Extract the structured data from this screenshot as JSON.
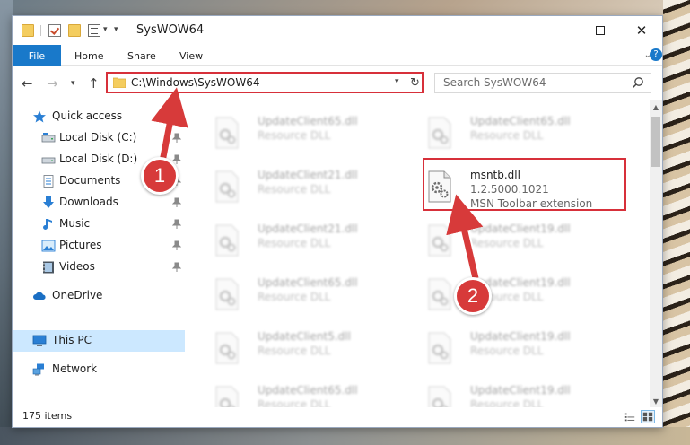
{
  "window": {
    "title": "SysWOW64"
  },
  "ribbon": {
    "tabs": [
      {
        "label": "File"
      },
      {
        "label": "Home"
      },
      {
        "label": "Share"
      },
      {
        "label": "View"
      }
    ]
  },
  "navigation": {
    "address": "C:\\Windows\\SysWOW64",
    "search_placeholder": "Search SysWOW64"
  },
  "sidebar": {
    "items": [
      {
        "label": "Quick access",
        "icon": "star-icon"
      },
      {
        "label": "Local Disk (C:)",
        "icon": "drive-icon",
        "pinned": true
      },
      {
        "label": "Local Disk (D:)",
        "icon": "drive-icon",
        "pinned": true
      },
      {
        "label": "Documents",
        "icon": "documents-icon",
        "pinned": true
      },
      {
        "label": "Downloads",
        "icon": "download-icon",
        "pinned": true
      },
      {
        "label": "Music",
        "icon": "music-icon",
        "pinned": true
      },
      {
        "label": "Pictures",
        "icon": "pictures-icon",
        "pinned": true
      },
      {
        "label": "Videos",
        "icon": "videos-icon",
        "pinned": true
      },
      {
        "label": "OneDrive",
        "icon": "cloud-icon"
      },
      {
        "label": "This PC",
        "icon": "computer-icon",
        "selected": true
      },
      {
        "label": "Network",
        "icon": "network-icon"
      }
    ]
  },
  "files": [
    {
      "name": "UpdateClient65.dll",
      "type": "Resource DLL",
      "blurred": true
    },
    {
      "name": "UpdateClient65.dll",
      "type": "Resource DLL",
      "blurred": true
    },
    {
      "name": "UpdateClient21.dll",
      "type": "Resource DLL",
      "blurred": true
    },
    {
      "name": "msntb.dll",
      "version": "1.2.5000.1021",
      "description": "MSN Toolbar extension",
      "blurred": false
    },
    {
      "name": "UpdateClient21.dll",
      "type": "Resource DLL",
      "blurred": true
    },
    {
      "name": "UpdateClient19.dll",
      "type": "Resource DLL",
      "blurred": true
    },
    {
      "name": "UpdateClient65.dll",
      "type": "Resource DLL",
      "blurred": true
    },
    {
      "name": "UpdateClient19.dll",
      "type": "Resource DLL",
      "blurred": true
    },
    {
      "name": "UpdateClient5.dll",
      "type": "Resource DLL",
      "blurred": true
    },
    {
      "name": "UpdateClient19.dll",
      "type": "Resource DLL",
      "blurred": true
    },
    {
      "name": "UpdateClient65.dll",
      "type": "Resource DLL",
      "blurred": true
    },
    {
      "name": "UpdateClient19.dll",
      "type": "Resource DLL",
      "blurred": true
    }
  ],
  "status": {
    "item_count": "175 items"
  },
  "annotations": {
    "step1": "1",
    "step2": "2"
  },
  "colors": {
    "accent": "#1979ca",
    "highlight": "#d7303a",
    "selection": "#cce8ff"
  }
}
